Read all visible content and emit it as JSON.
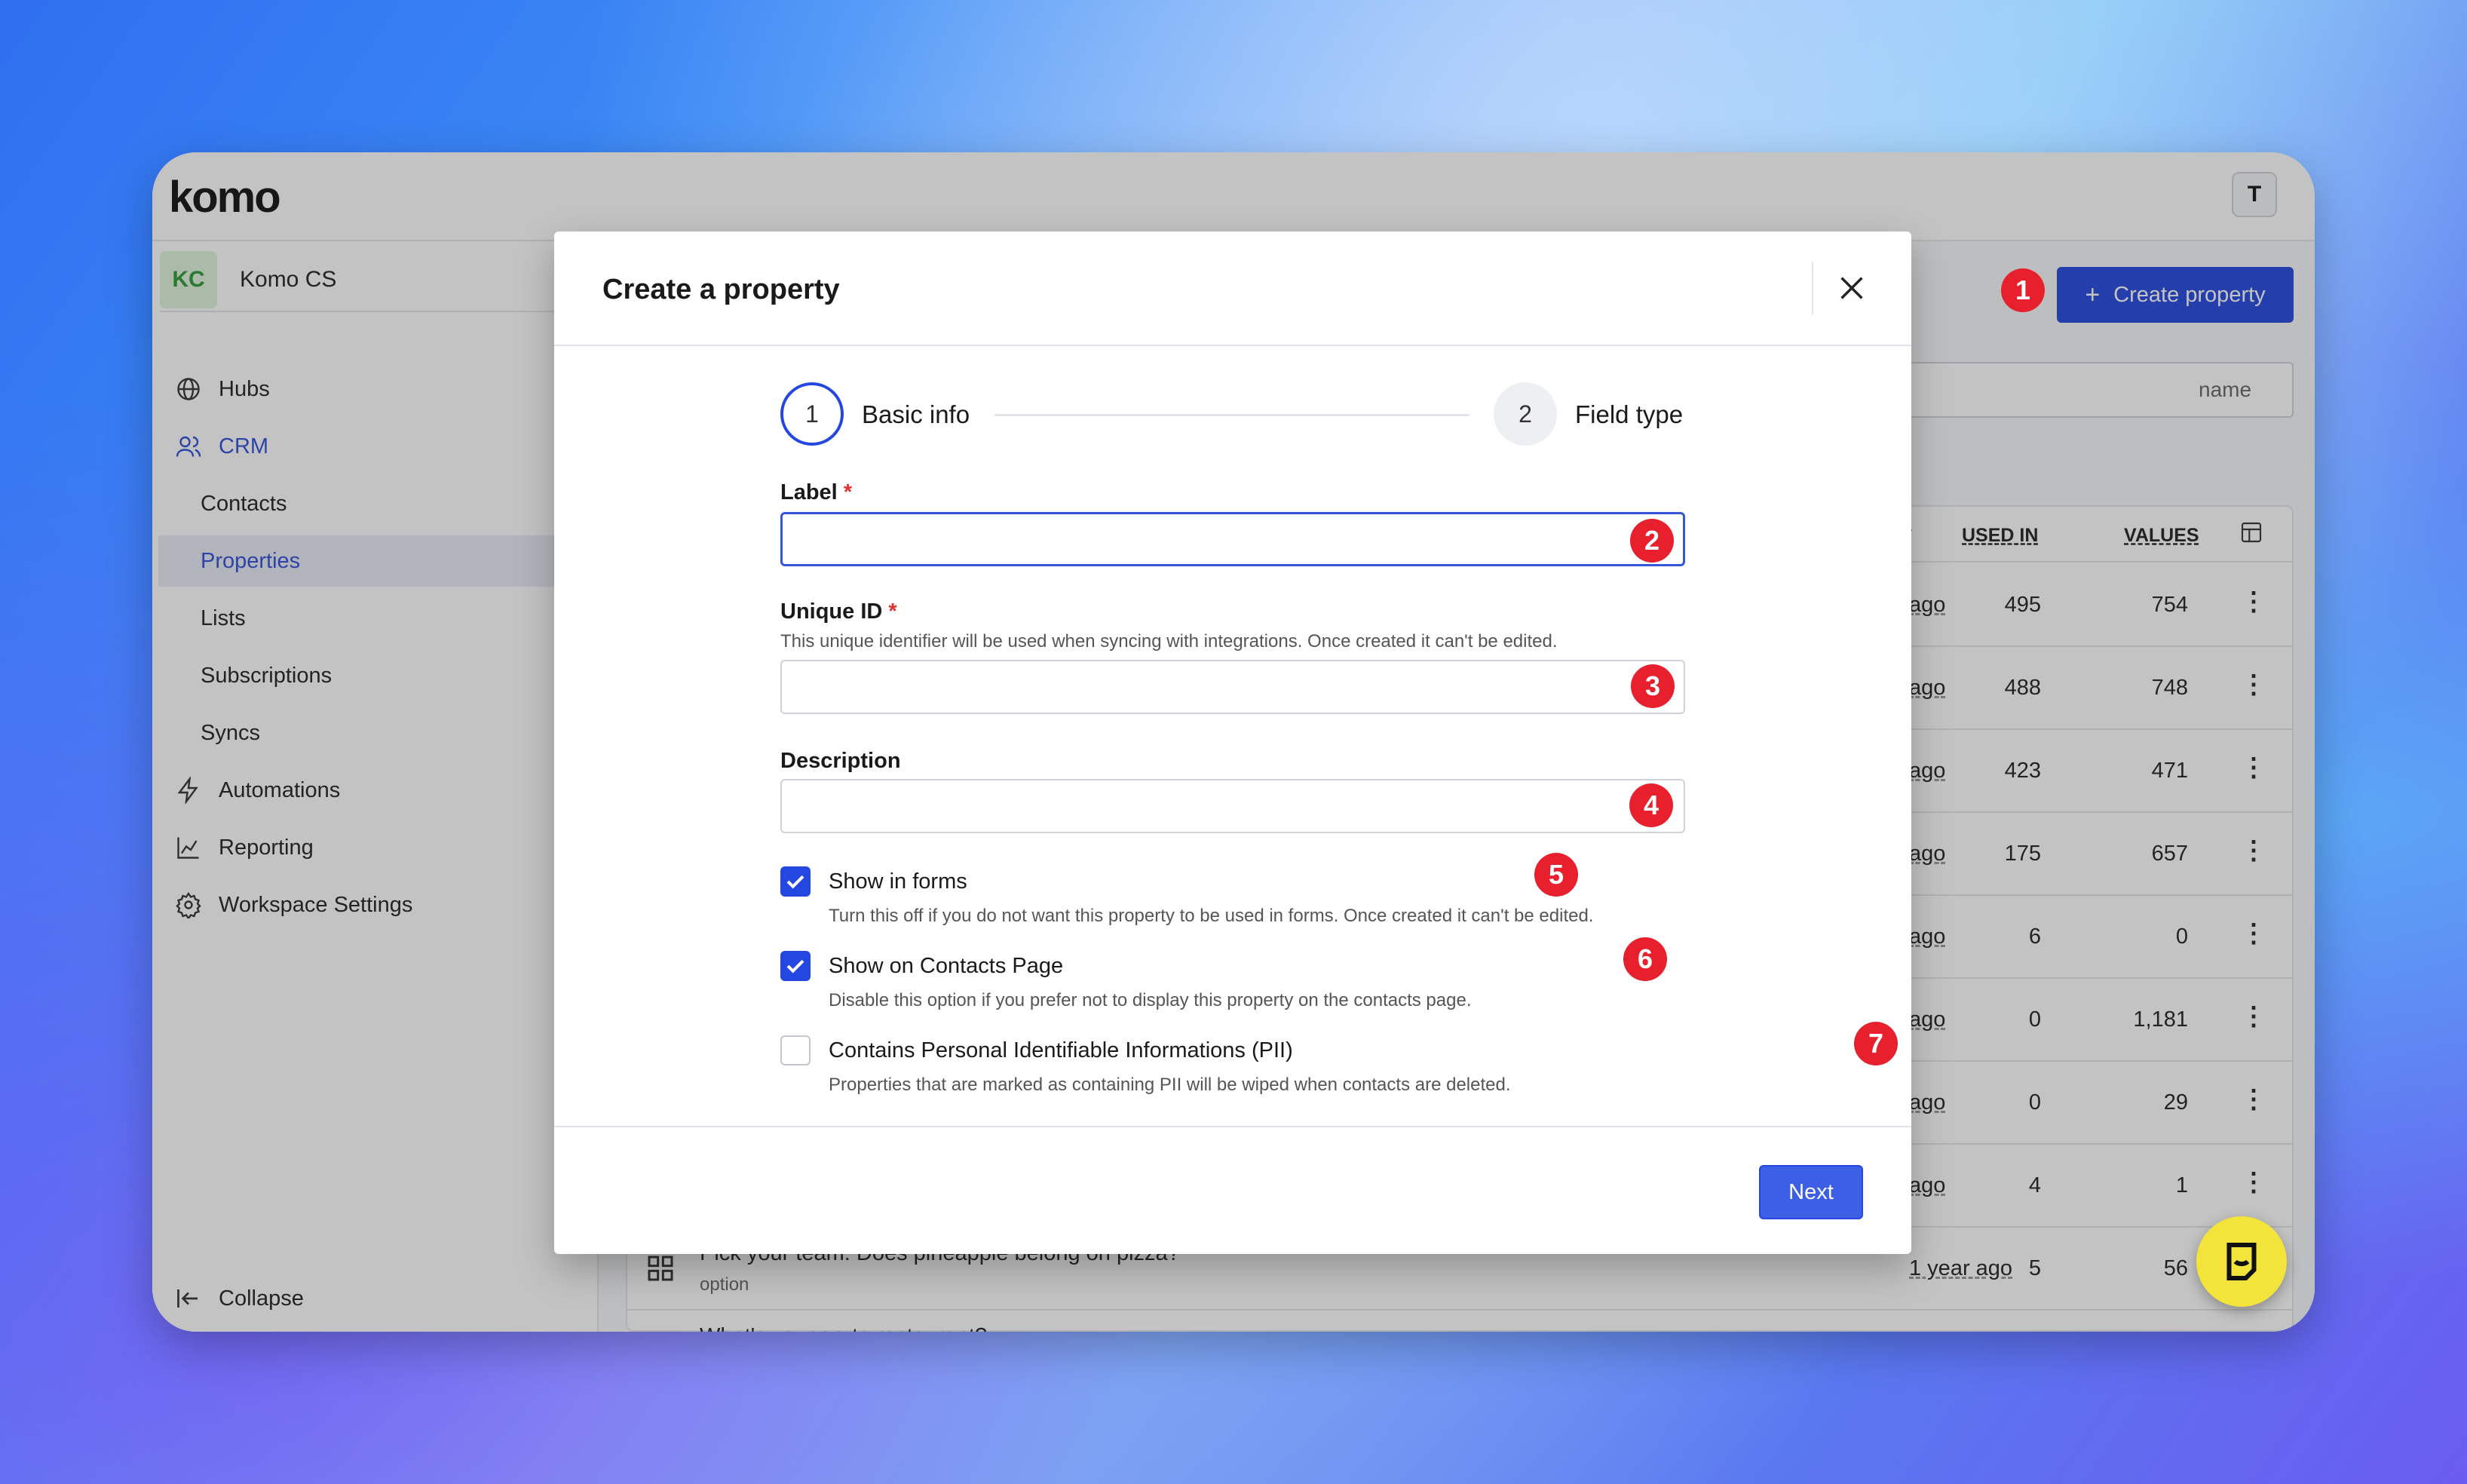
{
  "app": {
    "logo": "komo",
    "user_initial": "T"
  },
  "workspace": {
    "initials": "KC",
    "name": "Komo CS"
  },
  "sidebar": {
    "items": [
      {
        "label": "Hubs",
        "icon": "globe-icon"
      },
      {
        "label": "CRM",
        "icon": "users-icon"
      },
      {
        "label": "Contacts"
      },
      {
        "label": "Properties"
      },
      {
        "label": "Lists"
      },
      {
        "label": "Subscriptions"
      },
      {
        "label": "Syncs"
      },
      {
        "label": "Automations",
        "icon": "lightning-icon"
      },
      {
        "label": "Reporting",
        "icon": "chart-icon"
      },
      {
        "label": "Workspace Settings",
        "icon": "gear-icon"
      }
    ],
    "collapse_label": "Collapse"
  },
  "main": {
    "create_button": "Create property",
    "search_placeholder": "name",
    "table": {
      "headers": {
        "used_in": "USED IN",
        "values": "VALUES"
      },
      "rows": [
        {
          "ago": "ago",
          "used": "495",
          "values": "754"
        },
        {
          "ago": "ago",
          "used": "488",
          "values": "748"
        },
        {
          "ago": "ago",
          "used": "423",
          "values": "471"
        },
        {
          "ago": "ago",
          "used": "175",
          "values": "657"
        },
        {
          "ago": "ago",
          "used": "6",
          "values": "0"
        },
        {
          "ago": "ago",
          "used": "0",
          "values": "1,181"
        },
        {
          "ago": "ago",
          "used": "0",
          "values": "29"
        },
        {
          "ago": "ago",
          "used": "4",
          "values": "1"
        },
        {
          "title": "Pick your team: Does pineapple belong on pizza?",
          "sub": "option",
          "ago": "1 year ago",
          "used": "5",
          "values": "56"
        },
        {
          "title": "What's your go-to restaurant?"
        }
      ]
    }
  },
  "modal": {
    "title": "Create a property",
    "steps": [
      {
        "num": "1",
        "label": "Basic info"
      },
      {
        "num": "2",
        "label": "Field type"
      }
    ],
    "fields": {
      "label": {
        "label": "Label",
        "required": "*",
        "value": ""
      },
      "unique_id": {
        "label": "Unique ID",
        "required": "*",
        "help": "This unique identifier will be used when syncing with integrations. Once created it can't be edited.",
        "value": ""
      },
      "description": {
        "label": "Description",
        "value": ""
      }
    },
    "checkboxes": [
      {
        "label": "Show in forms",
        "help": "Turn this off if you do not want this property to be used in forms. Once created it can't be edited.",
        "checked": true
      },
      {
        "label": "Show on Contacts Page",
        "help": "Disable this option if you prefer not to display this property on the contacts page.",
        "checked": true
      },
      {
        "label": "Contains Personal Identifiable Informations (PII)",
        "help": "Properties that are marked as containing PII will be wiped when contacts are deleted.",
        "checked": false
      }
    ],
    "next_button": "Next"
  },
  "annotations": [
    "1",
    "2",
    "3",
    "4",
    "5",
    "6",
    "7"
  ],
  "colors": {
    "accent": "#2347e0",
    "annotation": "#e8202e",
    "fab": "#f2e43a"
  }
}
